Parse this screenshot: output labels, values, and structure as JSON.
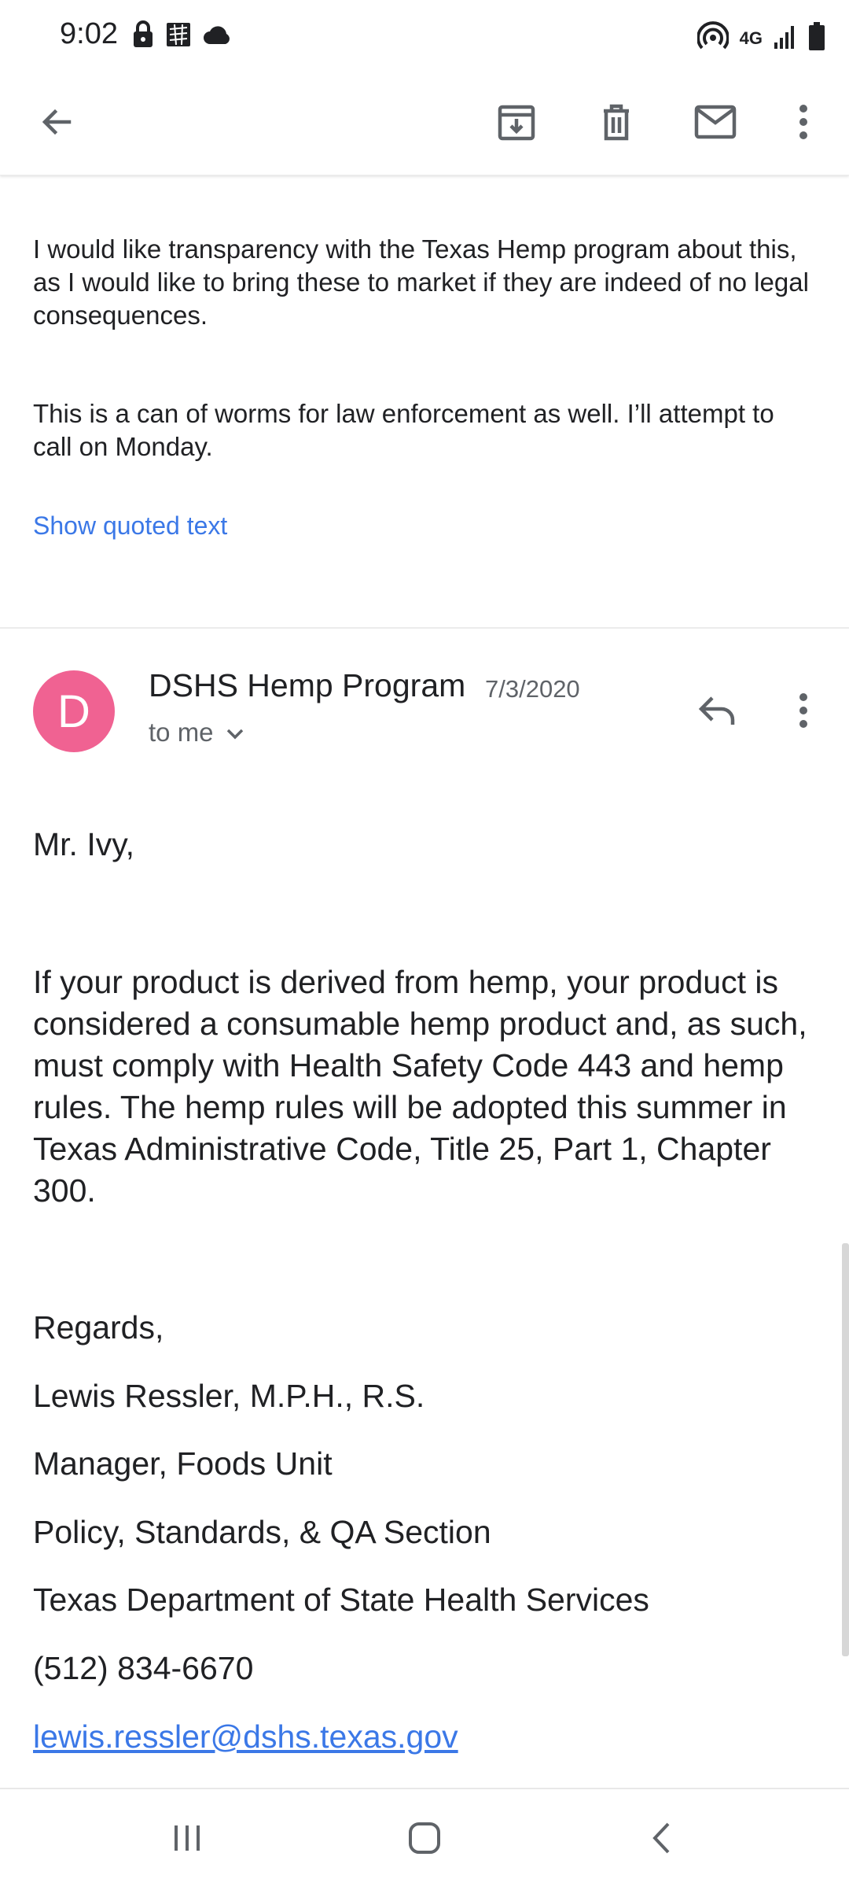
{
  "status_bar": {
    "time": "9:02",
    "left_icons": [
      "lock-icon",
      "app-notification-icon",
      "cloud-icon"
    ],
    "right_icons": [
      "hotspot-icon",
      "network-4g-icon",
      "signal-icon",
      "battery-icon"
    ],
    "network_label": "4G"
  },
  "toolbar": {
    "icons": [
      "arrow-back-icon",
      "archive-icon",
      "delete-icon",
      "mail-icon",
      "more-vert-icon"
    ]
  },
  "previous_message": {
    "paragraphs": [
      "I would like transparency with the Texas Hemp program about this, as I would like to bring these to market if they are indeed of no legal consequences.",
      "This is a can of worms for law enforcement as well. I’ll attempt to call on Monday."
    ],
    "show_quoted_text": "Show quoted text"
  },
  "message": {
    "avatar_letter": "D",
    "avatar_color": "#f06292",
    "sender": "DSHS Hemp Program",
    "date": "7/3/2020",
    "recipient": "to me",
    "salutation": "Mr. Ivy,",
    "body": "If your product is derived from hemp, your product is considered a consumable hemp product and, as such, must comply with Health Safety Code 443 and hemp rules. The hemp rules will be adopted this summer in Texas Administrative Code, Title 25, Part 1, Chapter 300.",
    "signature": [
      "Regards,",
      "Lewis Ressler, M.P.H., R.S.",
      "Manager, Foods Unit",
      "Policy, Standards, & QA Section",
      "Texas Department of State Health Services",
      "(512) 834-6670"
    ],
    "email": "lewis.ressler@dshs.texas.gov"
  },
  "colors": {
    "link": "#3b78e7",
    "text": "#202124",
    "secondary_text": "#5f6368",
    "icon": "#5f6368"
  },
  "nav_bar": {
    "icons": [
      "recents-icon",
      "home-icon",
      "nav-back-icon"
    ]
  }
}
